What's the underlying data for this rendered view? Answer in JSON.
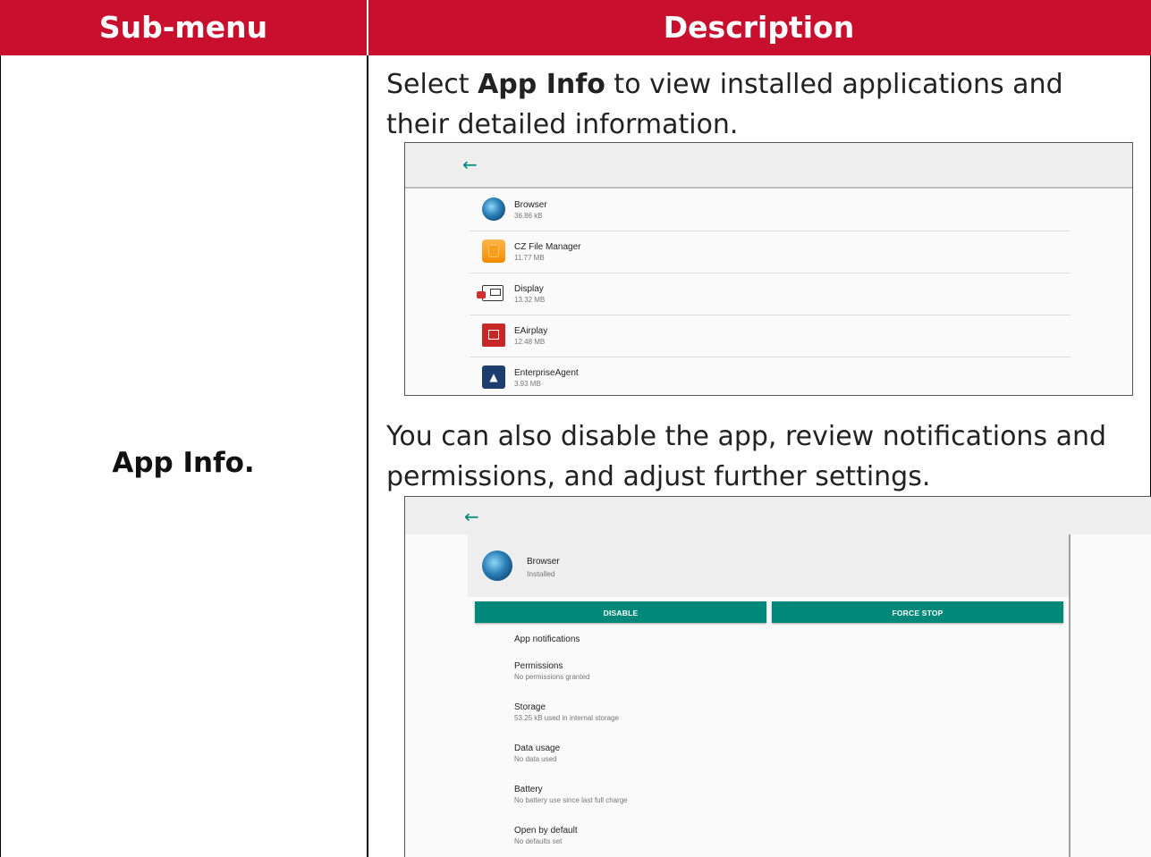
{
  "table": {
    "header_submenu": "Sub-menu",
    "header_description": "Description",
    "submenu_name": "App Info."
  },
  "description": {
    "p1_prefix": "Select ",
    "p1_bold": "App Info",
    "p1_suffix": " to view installed applications and their detailed information.",
    "p2": "You can also disable the app, review notifications and permissions, and adjust further settings."
  },
  "app_list": {
    "back_icon": "arrow-left-icon",
    "apps": [
      {
        "name": "Browser",
        "size": "36.86 kB",
        "icon": "browser-icon"
      },
      {
        "name": "CZ File Manager",
        "size": "11.77 MB",
        "icon": "file-manager-icon"
      },
      {
        "name": "Display",
        "size": "13.32 MB",
        "icon": "display-icon"
      },
      {
        "name": "EAirplay",
        "size": "12.48 MB",
        "icon": "eairplay-icon"
      },
      {
        "name": "EnterpriseAgent",
        "size": "3.93 MB",
        "icon": "enterprise-agent-icon"
      }
    ]
  },
  "app_detail": {
    "name": "Browser",
    "status": "Installed",
    "disable_label": "DISABLE",
    "force_stop_label": "FORCE STOP",
    "options": [
      {
        "title": "App notifications",
        "subtitle": ""
      },
      {
        "title": "Permissions",
        "subtitle": "No permissions granted"
      },
      {
        "title": "Storage",
        "subtitle": "53.25 kB used in internal storage"
      },
      {
        "title": "Data usage",
        "subtitle": "No data used"
      },
      {
        "title": "Battery",
        "subtitle": "No battery use since last full charge"
      },
      {
        "title": "Open by default",
        "subtitle": "No defaults set"
      }
    ]
  },
  "colors": {
    "header_red": "#c8102e",
    "accent_teal": "#00897b"
  }
}
